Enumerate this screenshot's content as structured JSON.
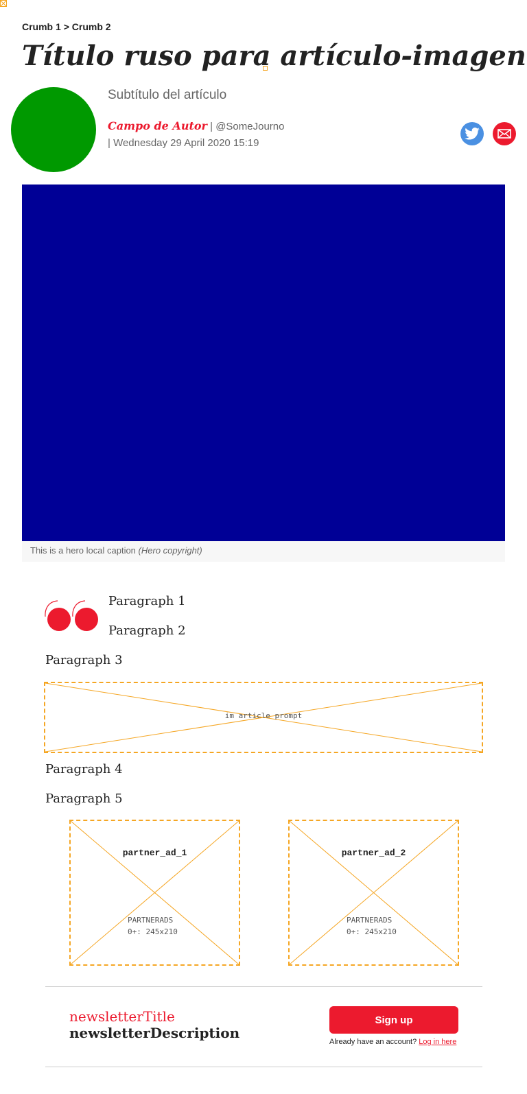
{
  "breadcrumb": {
    "items": [
      "Crumb 1",
      "Crumb 2"
    ],
    "separator": ">"
  },
  "article": {
    "title": "Título ruso para artículo-imagen",
    "subtitle": "Subtítulo del artículo",
    "author": "Campo de Autor",
    "handle": "@SomeJourno",
    "date": "Wednesday 29 April 2020 15:19"
  },
  "hero": {
    "caption": "This is a hero local caption",
    "copyright": "(Hero copyright)",
    "color": "#000096"
  },
  "share": {
    "twitter_icon": "twitter-icon",
    "email_icon": "email-icon"
  },
  "paragraphs": [
    "Paragraph 1",
    "Paragraph 2",
    "Paragraph 3",
    "Paragraph 4",
    "Paragraph 5"
  ],
  "ads": {
    "in_article": "im article prompt",
    "partner_1": {
      "name": "partner_ad_1",
      "label": "PARTNERADS",
      "size": "0+: 245x210"
    },
    "partner_2": {
      "name": "partner_ad_2",
      "label": "PARTNERADS",
      "size": "0+: 245x210"
    }
  },
  "newsletter": {
    "title": "newsletterTitle",
    "description": "newsletterDescription",
    "signup_label": "Sign up",
    "account_text": "Already have an account?",
    "login_link": "Log in here"
  },
  "colors": {
    "accent": "#ec1a2e",
    "avatar": "#009900",
    "twitter": "#4a90e2",
    "ad_border": "#f5a623"
  }
}
